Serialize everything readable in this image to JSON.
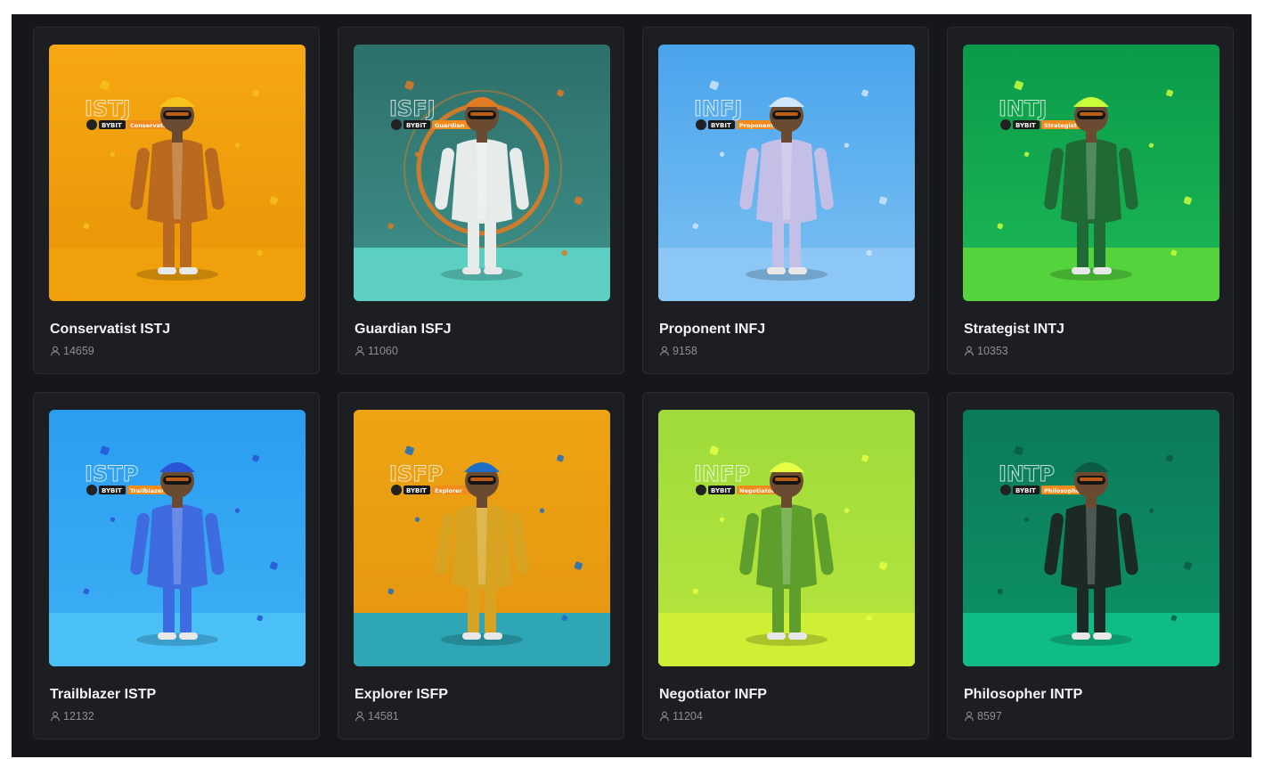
{
  "cards": [
    {
      "title": "Conservatist ISTJ",
      "count": "14659",
      "type_code": "ISTJ",
      "tag": "Conservatist",
      "brand": "BYBIT",
      "bg_top": "#f7a712",
      "bg_bottom": "#e89406",
      "floor": "#f0a10c",
      "figure": "#b96a1e",
      "accent": "#f6c21c",
      "icon": "user-icon"
    },
    {
      "title": "Guardian ISFJ",
      "count": "11060",
      "type_code": "ISFJ",
      "tag": "Guardian",
      "brand": "BYBIT",
      "bg_top": "#2e6f6a",
      "bg_bottom": "#3e918a",
      "floor": "#5fd6c8",
      "figure": "#e7ecea",
      "accent": "#e07a23",
      "icon": "user-icon"
    },
    {
      "title": "Proponent INFJ",
      "count": "9158",
      "type_code": "INFJ",
      "tag": "Proponent",
      "brand": "BYBIT",
      "bg_top": "#4aa4ec",
      "bg_bottom": "#7cc1f3",
      "floor": "#8fc8f6",
      "figure": "#c3bfe6",
      "accent": "#cfe6fb",
      "icon": "user-icon"
    },
    {
      "title": "Strategist INTJ",
      "count": "10353",
      "type_code": "INTJ",
      "tag": "Strategist",
      "brand": "BYBIT",
      "bg_top": "#0b9a4a",
      "bg_bottom": "#1cb955",
      "floor": "#5cd63a",
      "figure": "#1f6a35",
      "accent": "#c9ff3a",
      "icon": "user-icon"
    },
    {
      "title": "Trailblazer ISTP",
      "count": "12132",
      "type_code": "ISTP",
      "tag": "Trailblazer",
      "brand": "BYBIT",
      "bg_top": "#2b9df0",
      "bg_bottom": "#3db0f5",
      "floor": "#4cc2f7",
      "figure": "#3f6be0",
      "accent": "#2a54d6",
      "icon": "user-icon"
    },
    {
      "title": "Explorer ISFP",
      "count": "14581",
      "type_code": "ISFP",
      "tag": "Explorer",
      "brand": "BYBIT",
      "bg_top": "#eda413",
      "bg_bottom": "#e39510",
      "floor": "#1aa7c9",
      "figure": "#d7a321",
      "accent": "#1c6fc4",
      "icon": "user-icon"
    },
    {
      "title": "Negotiator INFP",
      "count": "11204",
      "type_code": "INFP",
      "tag": "Negotiator",
      "brand": "BYBIT",
      "bg_top": "#9fdb3b",
      "bg_bottom": "#b6e53b",
      "floor": "#d2ef34",
      "figure": "#5d9e2c",
      "accent": "#e6ff45",
      "icon": "user-icon"
    },
    {
      "title": "Philosopher INTP",
      "count": "8597",
      "type_code": "INTP",
      "tag": "Philosopher",
      "brand": "BYBIT",
      "bg_top": "#0b7a5a",
      "bg_bottom": "#0d9366",
      "floor": "#0fc08a",
      "figure": "#1b2a25",
      "accent": "#0a5c44",
      "icon": "user-icon"
    }
  ]
}
